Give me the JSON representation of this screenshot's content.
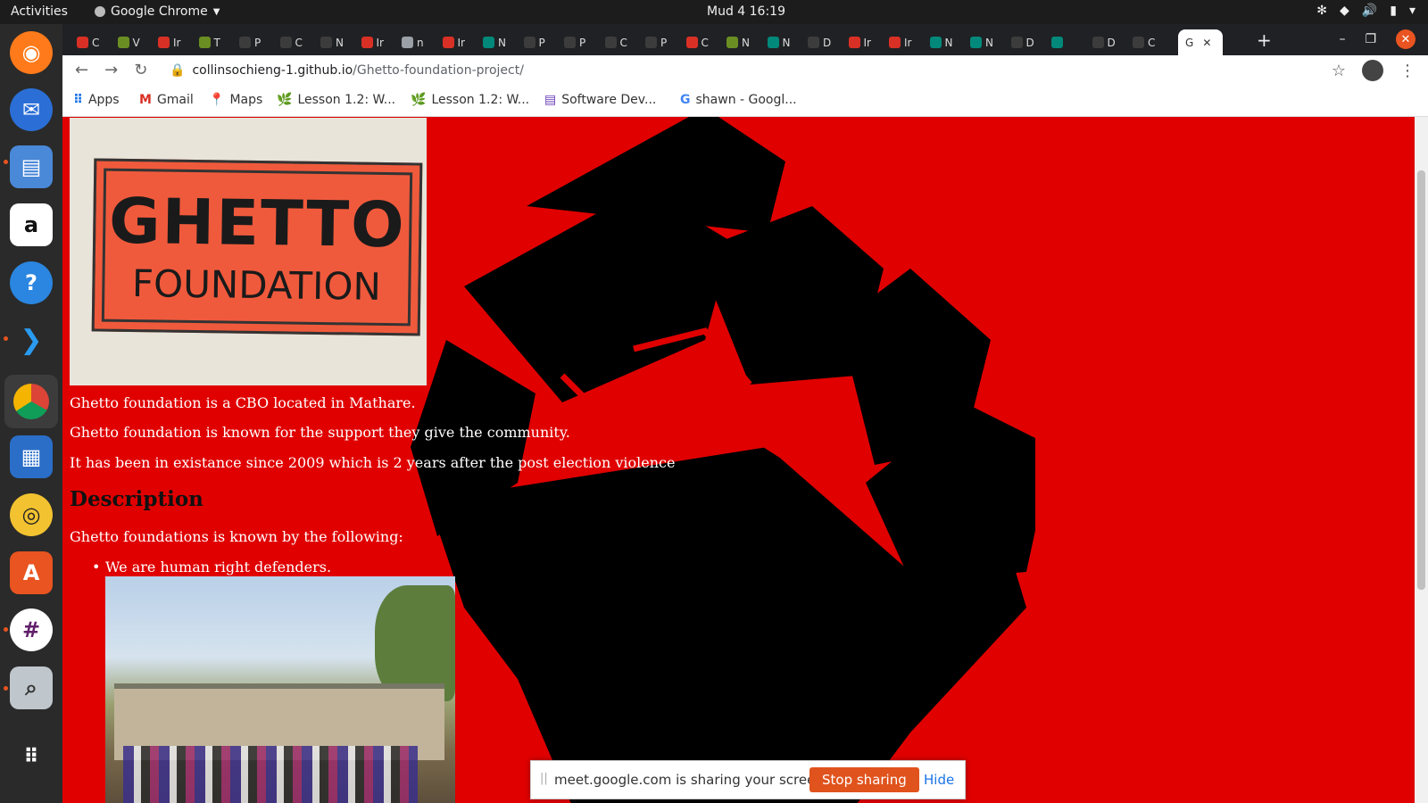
{
  "system": {
    "activities_label": "Activities",
    "app_name": "Google Chrome",
    "clock": "Mud 4  16:19"
  },
  "browser": {
    "tabs": [
      {
        "letter": "C",
        "icon": "gmail-icon"
      },
      {
        "letter": "V",
        "icon": "tree-icon"
      },
      {
        "letter": "Ir",
        "icon": "gmail-icon"
      },
      {
        "letter": "T",
        "icon": "tree-icon"
      },
      {
        "letter": "P",
        "icon": "github-icon"
      },
      {
        "letter": "C",
        "icon": "github-icon"
      },
      {
        "letter": "N",
        "icon": "github-icon"
      },
      {
        "letter": "Ir",
        "icon": "gmail-icon"
      },
      {
        "letter": "n",
        "icon": "globe-icon"
      },
      {
        "letter": "Ir",
        "icon": "gmail-icon"
      },
      {
        "letter": "N",
        "icon": "meet-icon"
      },
      {
        "letter": "P",
        "icon": "github-icon"
      },
      {
        "letter": "P",
        "icon": "github-icon"
      },
      {
        "letter": "C",
        "icon": "github-icon"
      },
      {
        "letter": "P",
        "icon": "github-icon"
      },
      {
        "letter": "C",
        "icon": "gmail-icon"
      },
      {
        "letter": "N",
        "icon": "tree-icon"
      },
      {
        "letter": "N",
        "icon": "meet-icon"
      },
      {
        "letter": "D",
        "icon": "github-icon"
      },
      {
        "letter": "Ir",
        "icon": "gmail-icon"
      },
      {
        "letter": "Ir",
        "icon": "gmail-icon"
      },
      {
        "letter": "N",
        "icon": "meet-icon"
      },
      {
        "letter": "N",
        "icon": "meet-icon"
      },
      {
        "letter": "D",
        "icon": "github-icon"
      },
      {
        "letter": "",
        "icon": "meet-icon"
      },
      {
        "letter": "D",
        "icon": "github-icon"
      },
      {
        "letter": "C",
        "icon": "github-icon"
      }
    ],
    "active_tab_letter": "G",
    "url_host": "collinsochieng-1.github.io",
    "url_path": "/Ghetto-foundation-project/",
    "bookmarks": [
      {
        "label": "Apps",
        "icon": "apps-grid-icon"
      },
      {
        "label": "Gmail",
        "icon": "gmail-icon"
      },
      {
        "label": "Maps",
        "icon": "maps-pin-icon"
      },
      {
        "label": "Lesson 1.2: W...",
        "icon": "tree-icon"
      },
      {
        "label": "Lesson 1.2: W...",
        "icon": "tree-icon"
      },
      {
        "label": "Software Dev...",
        "icon": "form-icon"
      },
      {
        "label": "shawn - Googl...",
        "icon": "google-icon"
      }
    ]
  },
  "page": {
    "logo_line1": "GHETTO",
    "logo_line2": "FOUNDATION",
    "paragraphs": [
      "Ghetto foundation is a CBO located in Mathare.",
      "Ghetto foundation is known for the support they give the community.",
      "It has been in existance since 2009 which is 2 years after the post election violence"
    ],
    "description_heading": "Description",
    "description_intro": "Ghetto foundations is known by the following:",
    "bullets": [
      "We are human right defenders."
    ],
    "colors": {
      "background": "#e00000",
      "fist": "#000000"
    }
  },
  "share_bar": {
    "message": "meet.google.com is sharing your screen.",
    "stop_label": "Stop sharing",
    "hide_label": "Hide"
  }
}
